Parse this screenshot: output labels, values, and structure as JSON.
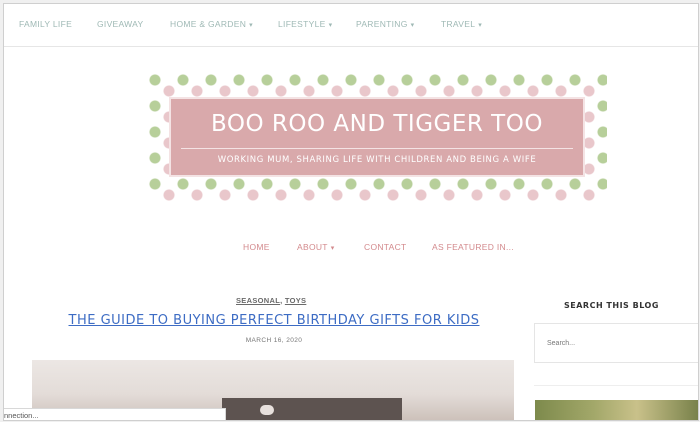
{
  "top_nav": {
    "items": [
      {
        "label": "FAMILY LIFE",
        "dropdown": false
      },
      {
        "label": "GIVEAWAY",
        "dropdown": false
      },
      {
        "label": "HOME & GARDEN",
        "dropdown": true
      },
      {
        "label": "LIFESTYLE",
        "dropdown": true
      },
      {
        "label": "PARENTING",
        "dropdown": true
      },
      {
        "label": "TRAVEL",
        "dropdown": true
      }
    ]
  },
  "header": {
    "title": "BOO ROO AND TIGGER TOO",
    "tagline": "WORKING MUM, SHARING LIFE WITH CHILDREN AND BEING A WIFE"
  },
  "main_nav": {
    "items": [
      {
        "label": "HOME",
        "dropdown": false
      },
      {
        "label": "ABOUT",
        "dropdown": true
      },
      {
        "label": "CONTACT",
        "dropdown": false
      },
      {
        "label": "AS FEATURED IN...",
        "dropdown": false
      }
    ]
  },
  "post": {
    "categories": [
      "SEASONAL",
      "TOYS"
    ],
    "title": "THE GUIDE TO BUYING PERFECT BIRTHDAY GIFTS FOR KIDS",
    "date": "MARCH 16, 2020"
  },
  "sidebar": {
    "search_title": "SEARCH THIS BLOG",
    "search_placeholder": "Search..."
  },
  "status_bar": {
    "text": "nnection..."
  },
  "colors": {
    "top_nav_text": "#9fb9b5",
    "main_nav_text": "#d38a8d",
    "banner_pink": "#d9a9ab",
    "link_blue": "#3d6cc4"
  }
}
